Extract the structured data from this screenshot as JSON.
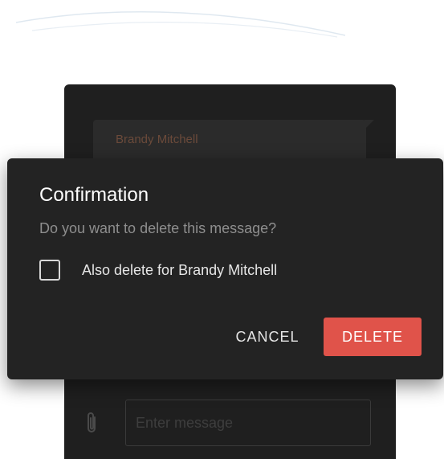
{
  "chat": {
    "author": "Brandy Mitchell",
    "composer_placeholder": "Enter message"
  },
  "dialog": {
    "title": "Confirmation",
    "message": "Do you want to delete this message?",
    "checkbox_label": "Also delete for Brandy Mitchell",
    "checkbox_checked": false,
    "cancel_label": "CANCEL",
    "delete_label": "DELETE"
  },
  "icons": {
    "attach": "paperclip-icon",
    "checkbox": "checkbox-unchecked-icon"
  },
  "colors": {
    "dialog_background": "#232323",
    "chat_background": "#1f1f1f",
    "delete_button": "#e0534a",
    "author_name": "#6b4a3a",
    "message_text": "#8e8e8e"
  }
}
